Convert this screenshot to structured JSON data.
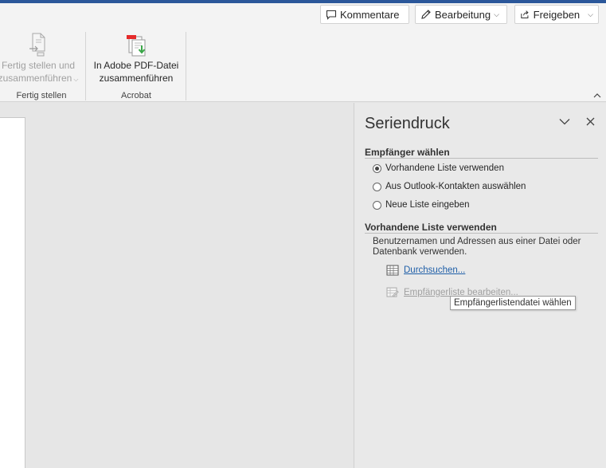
{
  "toolbar": {
    "kommentare_label": "Kommentare",
    "bearbeitung_label": "Bearbeitung",
    "freigeben_label": "Freigeben"
  },
  "ribbon": {
    "fertig_button": {
      "line1": "Fertig stellen und",
      "line2": "zusammenführen"
    },
    "fertig_group_label": "Fertig stellen",
    "acrobat_button": {
      "line1": "In Adobe PDF-Datei",
      "line2": "zusammenführen"
    },
    "acrobat_group_label": "Acrobat"
  },
  "pane": {
    "title": "Seriendruck",
    "recipients_heading": "Empfänger wählen",
    "options": [
      {
        "label": "Vorhandene Liste verwenden",
        "selected": true
      },
      {
        "label": "Aus Outlook-Kontakten auswählen",
        "selected": false
      },
      {
        "label": "Neue Liste eingeben",
        "selected": false
      }
    ],
    "existing_heading": "Vorhandene Liste verwenden",
    "description": "Benutzernamen und Adressen aus einer Datei oder Datenbank verwenden.",
    "browse_link": "Durchsuchen...",
    "edit_link": "Empfängerliste bearbeiten...",
    "tooltip": "Empfängerlistendatei wählen"
  },
  "icons": {
    "comment": "comment-icon",
    "pencil": "pencil-icon",
    "share": "share-icon",
    "finish_merge": "finish-merge-icon",
    "pdf_merge": "pdf-merge-icon",
    "chevron_down": "chevron-down-icon",
    "close": "close-icon",
    "collapse": "collapse-ribbon-icon",
    "table": "table-icon",
    "edit_list": "edit-list-icon"
  }
}
